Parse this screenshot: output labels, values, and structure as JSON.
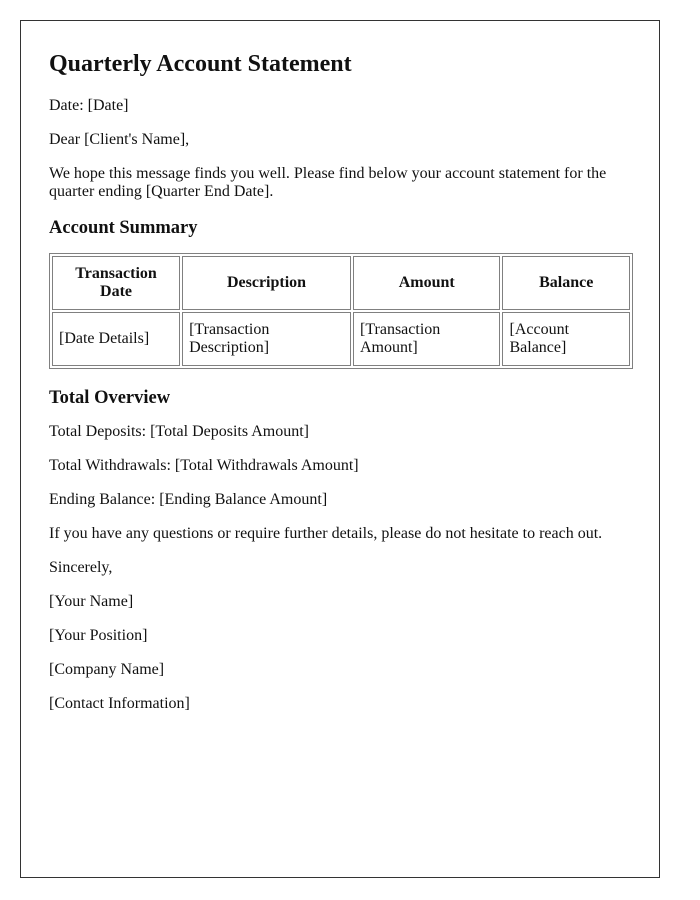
{
  "document": {
    "title": "Quarterly Account Statement",
    "date_line": "Date: [Date]",
    "salutation": "Dear [Client's Name],",
    "intro": "We hope this message finds you well. Please find below your account statement for the quarter ending [Quarter End Date]."
  },
  "account_summary": {
    "heading": "Account Summary",
    "table": {
      "headers": [
        "Transaction Date",
        "Description",
        "Amount",
        "Balance"
      ],
      "rows": [
        [
          "[Date Details]",
          "[Transaction Description]",
          "[Transaction Amount]",
          "[Account Balance]"
        ]
      ]
    }
  },
  "total_overview": {
    "heading": "Total Overview",
    "total_deposits": "Total Deposits: [Total Deposits Amount]",
    "total_withdrawals": "Total Withdrawals: [Total Withdrawals Amount]",
    "ending_balance": "Ending Balance: [Ending Balance Amount]"
  },
  "closing": {
    "note": "If you have any questions or require further details, please do not hesitate to reach out.",
    "sign_off": "Sincerely,",
    "your_name": "[Your Name]",
    "your_position": "[Your Position]",
    "company_name": "[Company Name]",
    "contact_information": "[Contact Information]"
  }
}
